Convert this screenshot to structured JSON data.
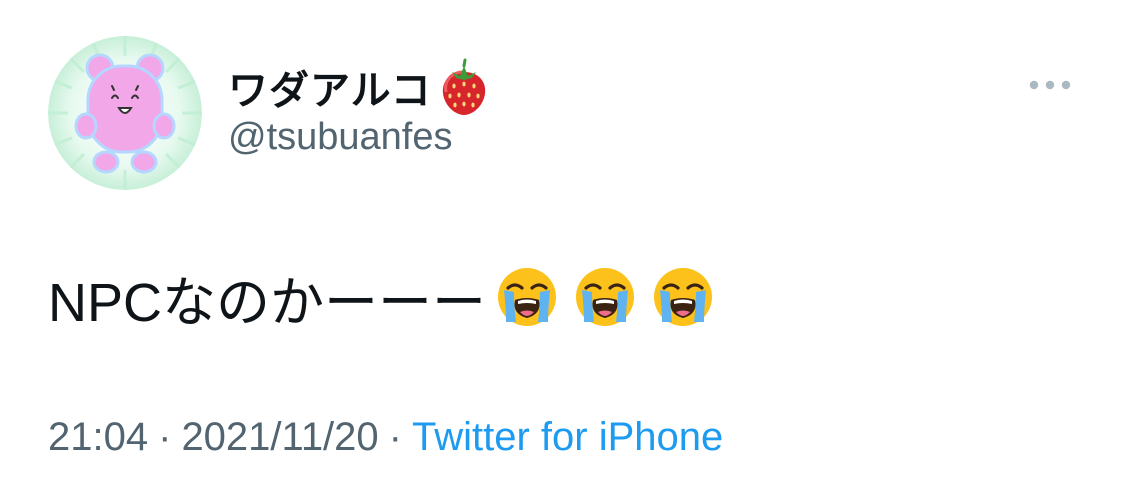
{
  "author": {
    "display_name": "ワダアルコ",
    "name_emoji": "strawberry-emoji",
    "handle": "@tsubuanfes",
    "avatar": "avatar-pink-bear"
  },
  "menu": {
    "icon": "more-icon"
  },
  "tweet": {
    "text": "NPCなのかーーー",
    "emojis": [
      "loudly-crying-face-emoji",
      "loudly-crying-face-emoji",
      "loudly-crying-face-emoji"
    ]
  },
  "meta": {
    "time": "21:04",
    "separator": "·",
    "date": "2021/11/20",
    "source": "Twitter for iPhone"
  },
  "colors": {
    "text": "#0f1419",
    "secondary": "#536471",
    "link": "#1d9bf0",
    "avatar_bg": "#d6f5e3",
    "avatar_bear": "#f2a7e8"
  }
}
